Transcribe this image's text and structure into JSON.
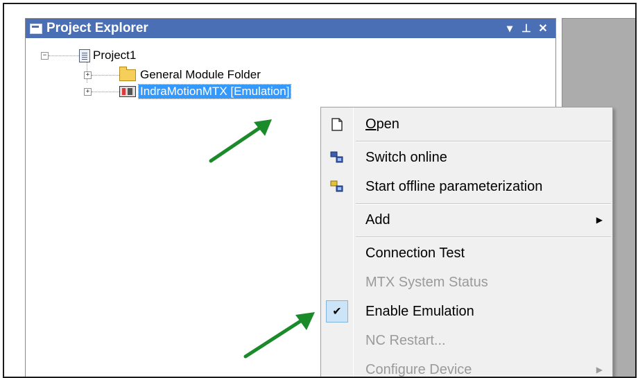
{
  "panel": {
    "title": "Project Explorer",
    "buttons": {
      "dropdown": "▾",
      "pin": "⊥",
      "close": "✕"
    }
  },
  "tree": {
    "root": {
      "label": "Project1",
      "expander": "−"
    },
    "children": [
      {
        "label": "General Module Folder",
        "expander": "+",
        "icon": "folder-icon"
      },
      {
        "label": "IndraMotionMTX [Emulation]",
        "expander": "+",
        "icon": "device-icon",
        "selected": true
      }
    ]
  },
  "context_menu": {
    "items": [
      {
        "label": "Open",
        "mnemonic": "O",
        "rest": "pen",
        "icon": "open-document-icon",
        "enabled": true
      },
      {
        "label": "Switch online",
        "icon": "switch-online-icon",
        "enabled": true
      },
      {
        "label": "Start offline parameterization",
        "icon": "offline-parameterization-icon",
        "enabled": true
      },
      {
        "label": "Add",
        "submenu": true,
        "enabled": true
      },
      {
        "label": "Connection Test",
        "enabled": true
      },
      {
        "label": "MTX System Status",
        "enabled": false
      },
      {
        "label": "Enable Emulation",
        "checked": true,
        "check_mark": "✔",
        "enabled": true
      },
      {
        "label": "NC Restart...",
        "enabled": false
      },
      {
        "label": "Configure Device",
        "submenu": true,
        "enabled": false
      }
    ],
    "submenu_arrow": "▶"
  },
  "annotations": {
    "arrow_color": "#1b8a2a"
  },
  "colors": {
    "titlebar": "#4a6fb5",
    "selection": "#3399ff",
    "menu_bg": "#f0f0f0"
  }
}
